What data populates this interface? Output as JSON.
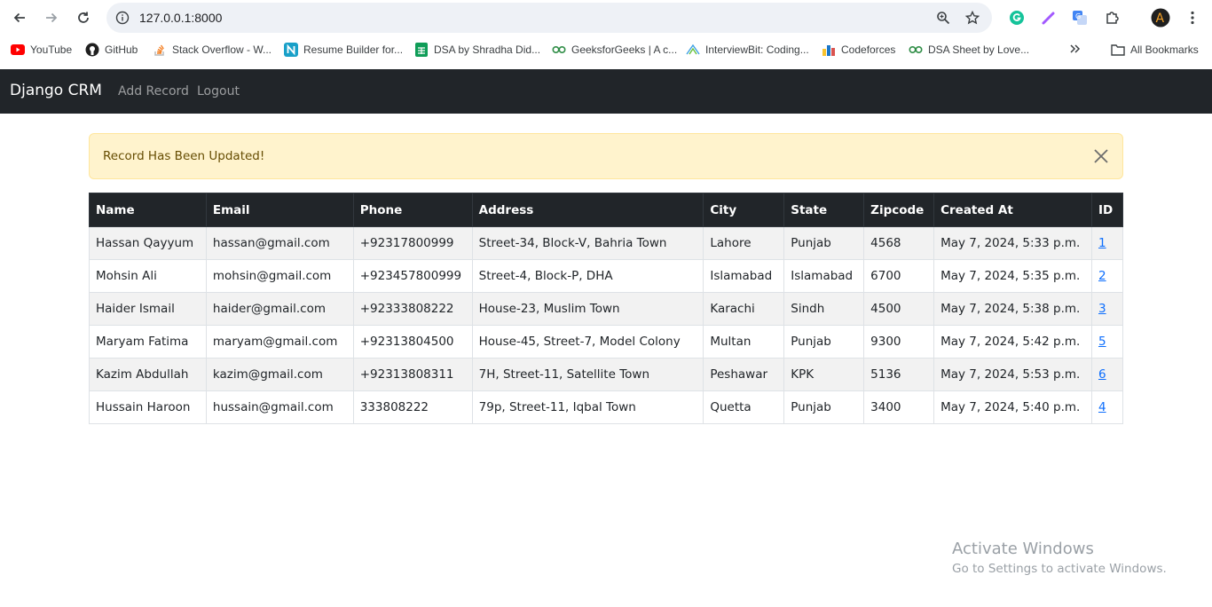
{
  "browser": {
    "url": "127.0.0.1:8000",
    "bookmarks": [
      {
        "label": "YouTube",
        "icon": "youtube-icon"
      },
      {
        "label": "GitHub",
        "icon": "github-icon"
      },
      {
        "label": "Stack Overflow - W...",
        "icon": "stackoverflow-icon"
      },
      {
        "label": "Resume Builder for...",
        "icon": "resume-icon"
      },
      {
        "label": "DSA by Shradha Did...",
        "icon": "sheets-icon"
      },
      {
        "label": "GeeksforGeeks | A c...",
        "icon": "gfg-icon"
      },
      {
        "label": "InterviewBit: Coding...",
        "icon": "interviewbit-icon"
      },
      {
        "label": "Codeforces",
        "icon": "codeforces-icon"
      },
      {
        "label": "DSA Sheet by Love...",
        "icon": "gfg-icon"
      }
    ],
    "all_bookmarks": "All Bookmarks",
    "profile_initial": "A"
  },
  "navbar": {
    "brand": "Django CRM",
    "links": [
      "Add Record",
      "Logout"
    ]
  },
  "alert": {
    "message": "Record Has Been Updated!"
  },
  "table": {
    "headers": [
      "Name",
      "Email",
      "Phone",
      "Address",
      "City",
      "State",
      "Zipcode",
      "Created At",
      "ID"
    ],
    "rows": [
      [
        "Hassan Qayyum",
        "hassan@gmail.com",
        "+92317800999",
        "Street-34, Block-V, Bahria Town",
        "Lahore",
        "Punjab",
        "4568",
        "May 7, 2024, 5:33 p.m.",
        "1"
      ],
      [
        "Mohsin Ali",
        "mohsin@gmail.com",
        "+923457800999",
        "Street-4, Block-P, DHA",
        "Islamabad",
        "Islamabad",
        "6700",
        "May 7, 2024, 5:35 p.m.",
        "2"
      ],
      [
        "Haider Ismail",
        "haider@gmail.com",
        "+92333808222",
        "House-23, Muslim Town",
        "Karachi",
        "Sindh",
        "4500",
        "May 7, 2024, 5:38 p.m.",
        "3"
      ],
      [
        "Maryam Fatima",
        "maryam@gmail.com",
        "+92313804500",
        "House-45, Street-7, Model Colony",
        "Multan",
        "Punjab",
        "9300",
        "May 7, 2024, 5:42 p.m.",
        "5"
      ],
      [
        "Kazim Abdullah",
        "kazim@gmail.com",
        "+92313808311",
        "7H, Street-11, Satellite Town",
        "Peshawar",
        "KPK",
        "5136",
        "May 7, 2024, 5:53 p.m.",
        "6"
      ],
      [
        "Hussain Haroon",
        "hussain@gmail.com",
        "333808222",
        "79p, Street-11, Iqbal Town",
        "Quetta",
        "Punjab",
        "3400",
        "May 7, 2024, 5:40 p.m.",
        "4"
      ]
    ]
  },
  "watermark": {
    "title": "Activate Windows",
    "subtitle": "Go to Settings to activate Windows."
  }
}
